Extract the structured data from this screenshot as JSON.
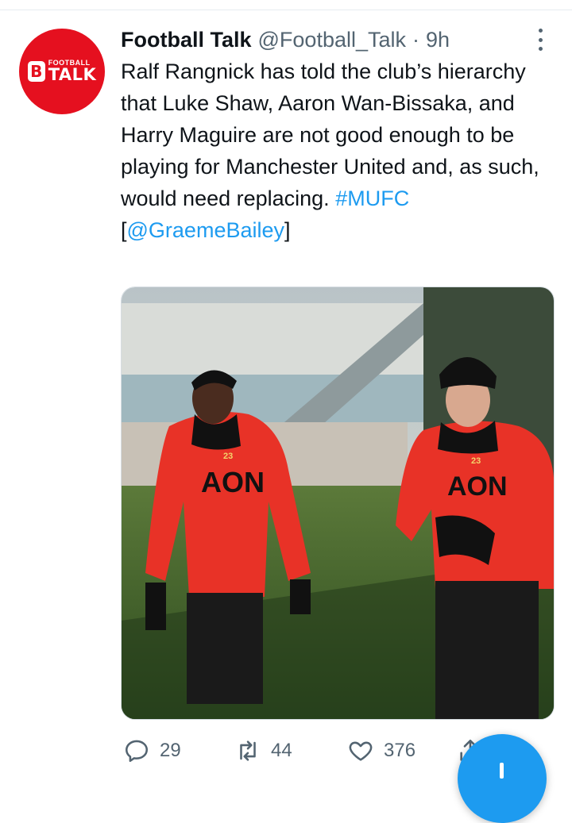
{
  "account": {
    "name": "Football Talk",
    "handle": "@Football_Talk",
    "separator": "·",
    "time": "9h",
    "avatar_logo": {
      "line1": "FOOTBALL",
      "line2": "TALK",
      "badge": "B",
      "color": "#e5101f"
    }
  },
  "tweet": {
    "text": "Ralf Rangnick has told the club’s hierarchy that Luke Shaw, Aaron Wan-Bissaka, and Harry Maguire are not good enough to be playing for Manchester United and, as such, would need replacing.",
    "hashtag": "#MUFC",
    "bracket_open": "[",
    "mention": "@GraemeBailey",
    "bracket_close": "]",
    "link_color": "#1d9bf0"
  },
  "media": {
    "shirt_sponsor": "AON",
    "shirt_number": "23"
  },
  "actions": {
    "replies": "29",
    "retweets": "44",
    "likes": "376"
  },
  "icons": {
    "more": "more-vertical-icon",
    "reply": "reply-icon",
    "retweet": "retweet-icon",
    "like": "heart-icon",
    "share": "share-icon",
    "compose": "compose-plus-icon"
  }
}
